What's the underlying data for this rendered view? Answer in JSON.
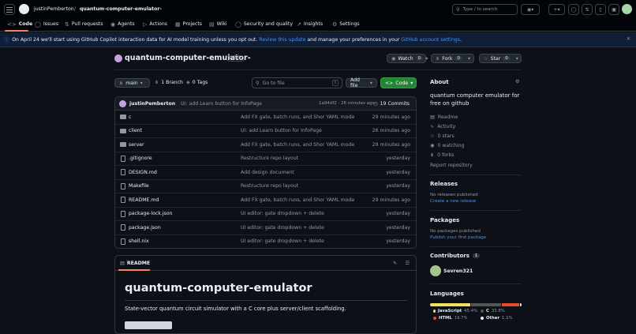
{
  "header": {
    "owner": "justinPemberton",
    "slash": "/",
    "repo": "quantum-computer-emulator-",
    "search_placeholder": "Type / to search"
  },
  "tabs": [
    {
      "label": "Code",
      "icon": "code-icon"
    },
    {
      "label": "Issues",
      "icon": "issue-icon"
    },
    {
      "label": "Pull requests",
      "icon": "pr-icon"
    },
    {
      "label": "Agents",
      "icon": "agent-icon"
    },
    {
      "label": "Actions",
      "icon": "play-icon"
    },
    {
      "label": "Projects",
      "icon": "table-icon"
    },
    {
      "label": "Wiki",
      "icon": "book-icon"
    },
    {
      "label": "Security and quality",
      "icon": "shield-icon"
    },
    {
      "label": "Insights",
      "icon": "graph-icon"
    },
    {
      "label": "Settings",
      "icon": "gear-icon"
    }
  ],
  "banner": {
    "text1": "On April 24 we'll start using GitHub Copilot interaction data for AI model training unless you opt out.",
    "link1": "Review this update",
    "text2": "and manage your preferences in your",
    "link2": "GitHub account settings",
    "text3": "."
  },
  "repo": {
    "name": "quantum-computer-emulator-",
    "visibility": "Public",
    "watch": "Watch",
    "watch_count": "0",
    "fork": "Fork",
    "fork_count": "0",
    "star": "Star",
    "star_count": "0"
  },
  "toolbar": {
    "branch": "main",
    "branches": "1 Branch",
    "tags": "0 Tags",
    "goto_placeholder": "Go to file",
    "goto_key": "t",
    "add_file": "Add file",
    "code": "Code"
  },
  "commit": {
    "author": "justinPemberton",
    "message": "UI: add Learn button for InfoPage",
    "hash": "1a94df2 · 26 minutes ago",
    "count": "19 Commits"
  },
  "files": [
    {
      "name": "c",
      "type": "dir",
      "msg": "Add FX gate, batch runs, and Shor YAML mode",
      "time": "29 minutes ago"
    },
    {
      "name": "client",
      "type": "dir",
      "msg": "UI: add Learn button for InfoPage",
      "time": "26 minutes ago"
    },
    {
      "name": "server",
      "type": "dir",
      "msg": "Add FX gate, batch runs, and Shor YAML mode",
      "time": "29 minutes ago"
    },
    {
      "name": ".gitignore",
      "type": "file",
      "msg": "Restructure repo layout",
      "time": "yesterday"
    },
    {
      "name": "DESIGN.md",
      "type": "file",
      "msg": "Add design document",
      "time": "yesterday"
    },
    {
      "name": "Makefile",
      "type": "file",
      "msg": "Restructure repo layout",
      "time": "yesterday"
    },
    {
      "name": "README.md",
      "type": "file",
      "msg": "Add FX gate, batch runs, and Shor YAML mode",
      "time": "29 minutes ago"
    },
    {
      "name": "package-lock.json",
      "type": "file",
      "msg": "UI editor: gate dropdown + delete",
      "time": "yesterday"
    },
    {
      "name": "package.json",
      "type": "file",
      "msg": "UI editor: gate dropdown + delete",
      "time": "yesterday"
    },
    {
      "name": "shell.nix",
      "type": "file",
      "msg": "UI editor: gate dropdown + delete",
      "time": "yesterday"
    }
  ],
  "readme": {
    "tab": "README",
    "title": "quantum-computer-emulator",
    "desc": "State-vector quantum circuit simulator with a C core plus server/client scaffolding."
  },
  "about": {
    "heading": "About",
    "desc_line1": "quantum computer emulator for",
    "desc_line2": "free on github",
    "readme": "Readme",
    "activity": "Activity",
    "stars": "0 stars",
    "watching": "0 watching",
    "forks": "0 forks",
    "report": "Report repository"
  },
  "releases": {
    "heading": "Releases",
    "none": "No releases published",
    "create": "Create a new release"
  },
  "packages": {
    "heading": "Packages",
    "none": "No packages published",
    "publish": "Publish your first package"
  },
  "contributors": {
    "heading": "Contributors",
    "count": "1",
    "name": "Sevren321"
  },
  "languages": {
    "heading": "Languages",
    "items": [
      {
        "name": "JavaScript",
        "pct": "45.4%",
        "pct_value": 45.4,
        "color": "#f1e05a"
      },
      {
        "name": "C",
        "pct": "33.8%",
        "pct_value": 33.8,
        "color": "#555555"
      },
      {
        "name": "HTML",
        "pct": "19.7%",
        "pct_value": 19.7,
        "color": "#e34c26"
      },
      {
        "name": "Other",
        "pct": "1.1%",
        "pct_value": 1.1,
        "color": "#ededed"
      }
    ]
  },
  "colors": {
    "accent": "#238636",
    "link": "#4493f8"
  }
}
